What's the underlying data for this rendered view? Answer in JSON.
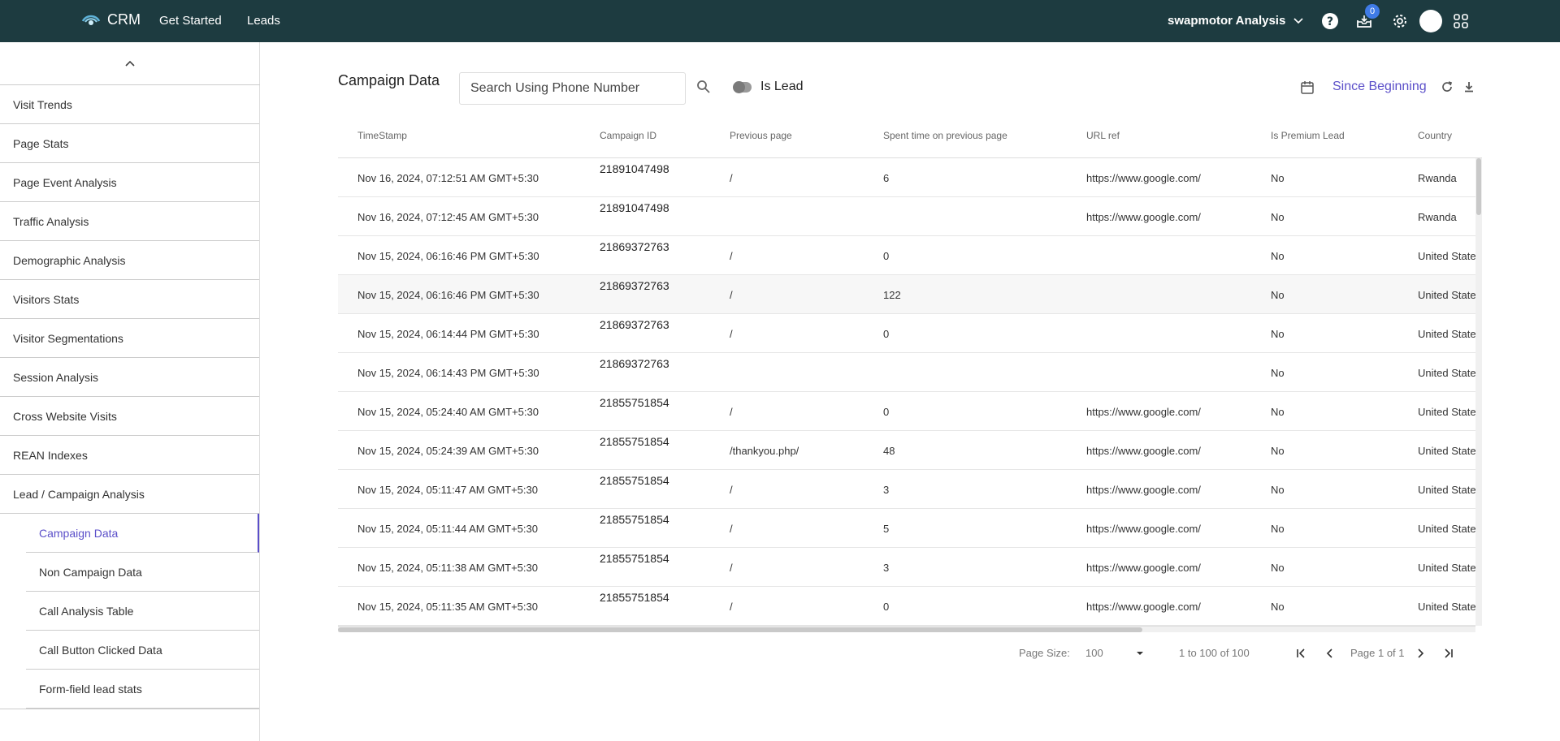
{
  "header": {
    "app_name": "CRM",
    "nav": [
      "Get Started",
      "Leads"
    ],
    "org_name": "swapmotor Analysis",
    "notification_count": "0"
  },
  "sidebar": {
    "items": [
      "Visit Trends",
      "Page Stats",
      "Page Event Analysis",
      "Traffic Analysis",
      "Demographic Analysis",
      "Visitors Stats",
      "Visitor Segmentations",
      "Session Analysis",
      "Cross Website Visits",
      "REAN Indexes",
      "Lead / Campaign Analysis"
    ],
    "sub_items": [
      "Campaign Data",
      "Non Campaign Data",
      "Call Analysis Table",
      "Call Button Clicked Data",
      "Form-field lead stats"
    ],
    "active_sub": "Campaign Data"
  },
  "main": {
    "title": "Campaign Data",
    "search_placeholder": "Search Using Phone Number",
    "toggle_label": "Is Lead",
    "date_range": "Since Beginning"
  },
  "table": {
    "columns": [
      "TimeStamp",
      "Campaign ID",
      "Previous page",
      "Spent time on previous page",
      "URL ref",
      "Is Premium Lead",
      "Country"
    ],
    "rows": [
      [
        "Nov 16, 2024, 07:12:51 AM GMT+5:30",
        "21891047498",
        "/",
        "6",
        "https://www.google.com/",
        "No",
        "Rwanda"
      ],
      [
        "Nov 16, 2024, 07:12:45 AM GMT+5:30",
        "21891047498",
        "",
        "",
        "https://www.google.com/",
        "No",
        "Rwanda"
      ],
      [
        "Nov 15, 2024, 06:16:46 PM GMT+5:30",
        "21869372763",
        "/",
        "0",
        "",
        "No",
        "United States"
      ],
      [
        "Nov 15, 2024, 06:16:46 PM GMT+5:30",
        "21869372763",
        "/",
        "122",
        "",
        "No",
        "United States"
      ],
      [
        "Nov 15, 2024, 06:14:44 PM GMT+5:30",
        "21869372763",
        "/",
        "0",
        "",
        "No",
        "United States"
      ],
      [
        "Nov 15, 2024, 06:14:43 PM GMT+5:30",
        "21869372763",
        "",
        "",
        "",
        "No",
        "United States"
      ],
      [
        "Nov 15, 2024, 05:24:40 AM GMT+5:30",
        "21855751854",
        "/",
        "0",
        "https://www.google.com/",
        "No",
        "United States"
      ],
      [
        "Nov 15, 2024, 05:24:39 AM GMT+5:30",
        "21855751854",
        "/thankyou.php/",
        "48",
        "https://www.google.com/",
        "No",
        "United States"
      ],
      [
        "Nov 15, 2024, 05:11:47 AM GMT+5:30",
        "21855751854",
        "/",
        "3",
        "https://www.google.com/",
        "No",
        "United States"
      ],
      [
        "Nov 15, 2024, 05:11:44 AM GMT+5:30",
        "21855751854",
        "/",
        "5",
        "https://www.google.com/",
        "No",
        "United States"
      ],
      [
        "Nov 15, 2024, 05:11:38 AM GMT+5:30",
        "21855751854",
        "/",
        "3",
        "https://www.google.com/",
        "No",
        "United States"
      ],
      [
        "Nov 15, 2024, 05:11:35 AM GMT+5:30",
        "21855751854",
        "/",
        "0",
        "https://www.google.com/",
        "No",
        "United States"
      ]
    ]
  },
  "pagination": {
    "page_size_label": "Page Size:",
    "page_size": "100",
    "range_text": "1 to 100 of 100",
    "page_text": "Page 1 of 1"
  }
}
